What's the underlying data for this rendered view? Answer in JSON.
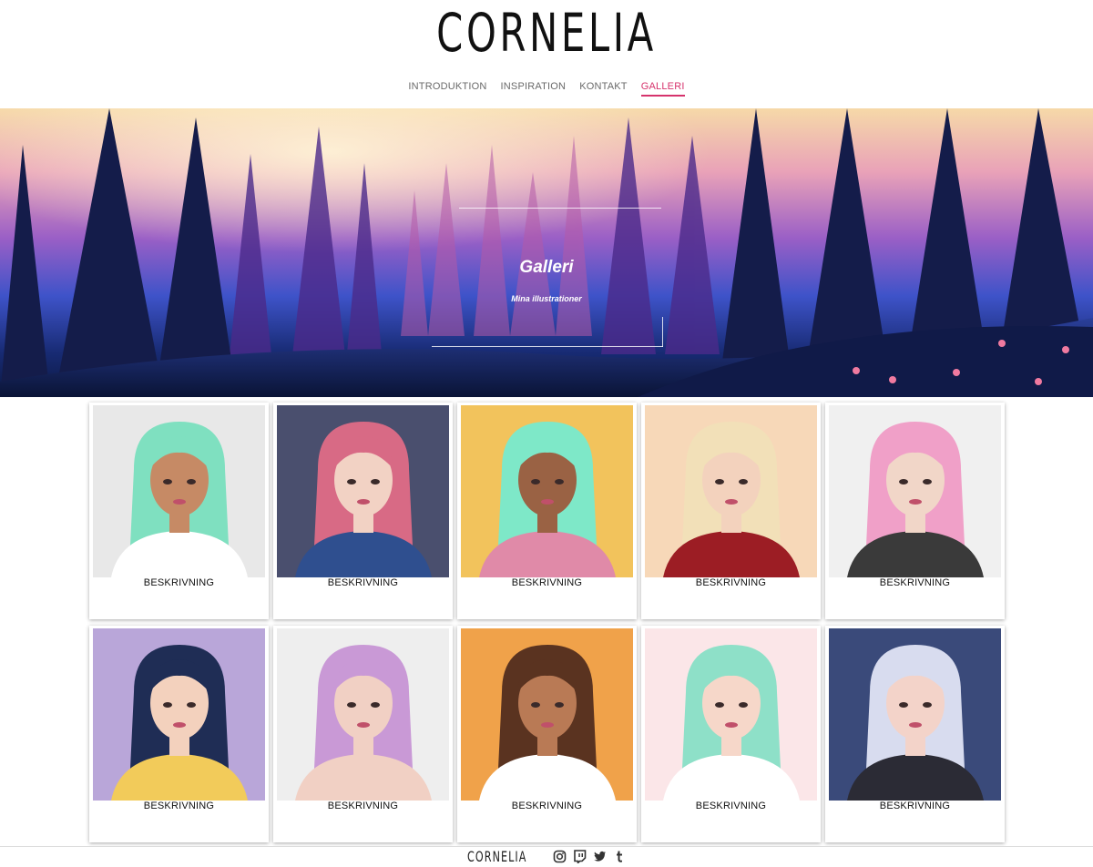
{
  "brand": {
    "logo": "CORNELIA",
    "footer_logo": "CORNELIA"
  },
  "nav": {
    "items": [
      {
        "label": "INTRODUKTION",
        "active": false
      },
      {
        "label": "INSPIRATION",
        "active": false
      },
      {
        "label": "KONTAKT",
        "active": false
      },
      {
        "label": "GALLERI",
        "active": true
      }
    ]
  },
  "hero": {
    "title": "Galleri",
    "subtitle": "Mina illustrationer"
  },
  "gallery": {
    "cards": [
      {
        "label": "BESKRIVNING",
        "bg": "#e8e8e8",
        "hair": "#7fe0c0",
        "skin": "#c68a65",
        "top": "#ffffff"
      },
      {
        "label": "BESKRIVNING",
        "bg": "#4a4f6e",
        "hair": "#d86a85",
        "skin": "#f2d2c4",
        "top": "#2f4f8f"
      },
      {
        "label": "BESKRIVNING",
        "bg": "#f2c35c",
        "hair": "#7ee8c8",
        "skin": "#9a6244",
        "top": "#e08aa8"
      },
      {
        "label": "BESKRIVNING",
        "bg": "#f7d8b8",
        "hair": "#f2e0b8",
        "skin": "#f3d2bd",
        "top": "#9c1d24"
      },
      {
        "label": "BESKRIVNING",
        "bg": "#f0f0f0",
        "hair": "#f0a0c8",
        "skin": "#f1d6c8",
        "top": "#3a3a3a"
      },
      {
        "label": "BESKRIVNING",
        "bg": "#b9a6d9",
        "hair": "#1f2d55",
        "skin": "#f3d1bd",
        "top": "#f2cb5a"
      },
      {
        "label": "BESKRIVNING",
        "bg": "#eeeeee",
        "hair": "#c999d6",
        "skin": "#f1d0c4",
        "top": "#f1d0c4"
      },
      {
        "label": "BESKRIVNING",
        "bg": "#f0a24a",
        "hair": "#5a3320",
        "skin": "#b97a55",
        "top": "#ffffff"
      },
      {
        "label": "BESKRIVNING",
        "bg": "#fbe6e8",
        "hair": "#8ee0c8",
        "skin": "#f6d7c9",
        "top": "#ffffff"
      },
      {
        "label": "BESKRIVNING",
        "bg": "#3a4a7a",
        "hair": "#d8dcef",
        "skin": "#f3d3c9",
        "top": "#2b2b35"
      }
    ]
  },
  "footer": {
    "social": [
      "instagram-icon",
      "twitch-icon",
      "twitter-icon",
      "tumblr-icon"
    ]
  }
}
